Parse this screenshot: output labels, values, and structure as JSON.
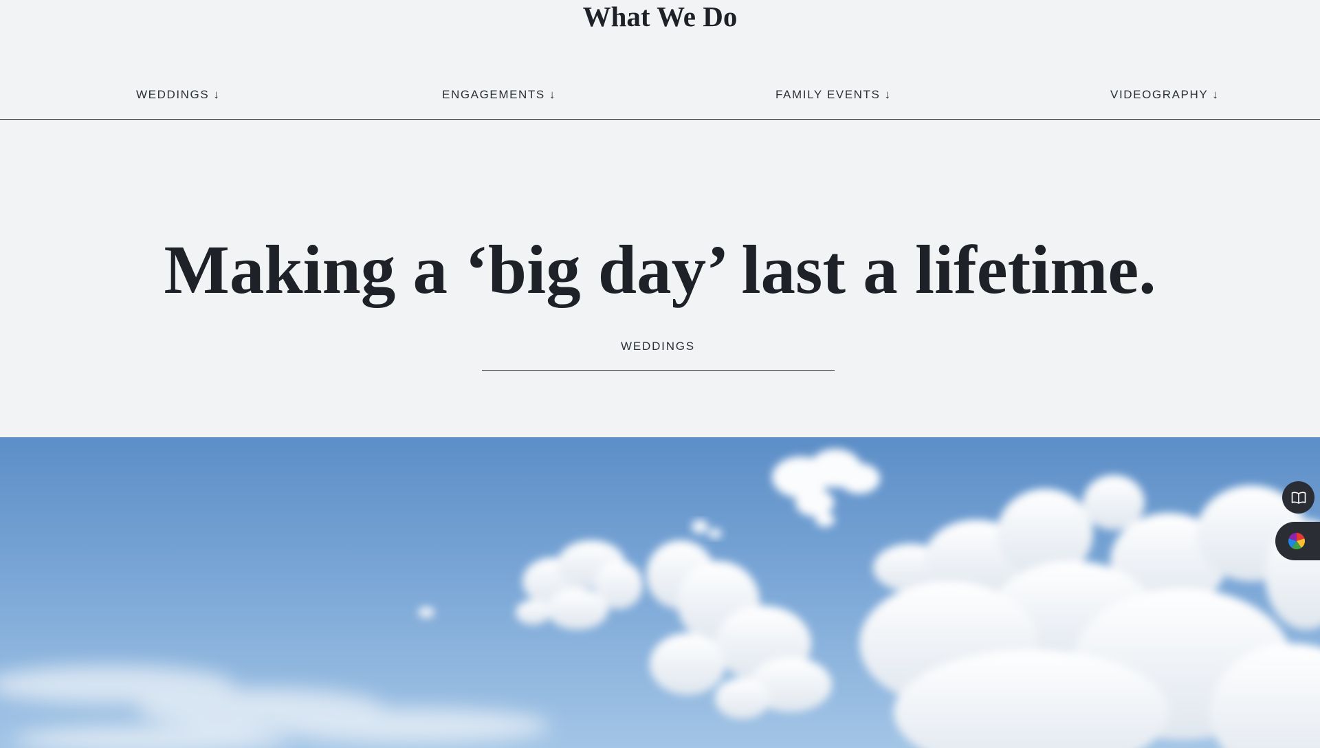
{
  "header": {
    "title": "What We Do"
  },
  "category_nav": {
    "items": [
      {
        "label": "WEDDINGS",
        "arrow": "↓"
      },
      {
        "label": "ENGAGEMENTS",
        "arrow": "↓"
      },
      {
        "label": "FAMILY EVENTS",
        "arrow": "↓"
      },
      {
        "label": "VIDEOGRAPHY",
        "arrow": "↓"
      }
    ]
  },
  "hero": {
    "heading": "Making a ‘big day’ last a lifetime.",
    "section_label": "WEDDINGS"
  },
  "image": {
    "subject": "blue sky with white clouds"
  },
  "floating_controls": {
    "reader_icon": "book-open-icon",
    "color_icon": "color-wheel-icon"
  },
  "colors": {
    "background": "#f2f3f5",
    "text": "#1e2228",
    "sky": "#7aa6d6",
    "floating_button": "#2a2d33"
  }
}
